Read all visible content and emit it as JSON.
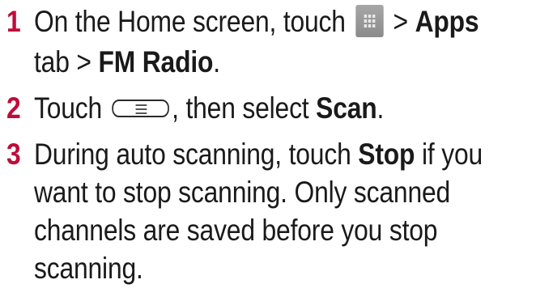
{
  "icons": {
    "apps": "apps-grid-icon",
    "menu": "menu-key-icon"
  },
  "colors": {
    "step_number": "#c00b3a",
    "text": "#1a1a1a"
  },
  "steps": [
    {
      "number": "1",
      "lines": [
        {
          "t1": "On the Home screen, touch",
          "t2": ">",
          "b1": "Apps"
        },
        {
          "t1": "tab >",
          "b1": "FM Radio",
          "t2": "."
        }
      ]
    },
    {
      "number": "2",
      "lines": [
        {
          "t1": "Touch",
          "t2": ", then select",
          "b1": "Scan",
          "t3": "."
        }
      ]
    },
    {
      "number": "3",
      "lines": [
        {
          "t1": "During auto scanning, touch",
          "b1": "Stop",
          "t2": "if you"
        },
        {
          "t1": "want to stop scanning. Only scanned"
        },
        {
          "t1": "channels are saved before you stop"
        },
        {
          "t1": "scanning."
        }
      ]
    }
  ]
}
